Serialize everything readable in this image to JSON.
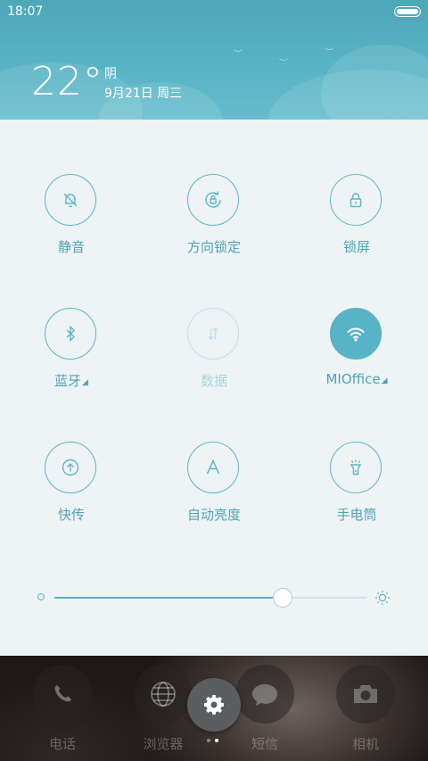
{
  "status_bar": {
    "time": "18:07",
    "battery_level": 1.0
  },
  "weather": {
    "temperature": "22°",
    "condition": "阴",
    "date": "9月21日 周三"
  },
  "toggles": [
    {
      "label": "静音",
      "icon": "bell-off-icon",
      "state": "off"
    },
    {
      "label": "方向锁定",
      "icon": "rotation-lock-icon",
      "state": "off"
    },
    {
      "label": "锁屏",
      "icon": "lock-icon",
      "state": "off"
    },
    {
      "label": "蓝牙",
      "icon": "bluetooth-icon",
      "state": "off",
      "has_menu": true
    },
    {
      "label": "数据",
      "icon": "mobile-data-icon",
      "state": "disabled"
    },
    {
      "label": "MIOffice",
      "icon": "wifi-icon",
      "state": "on",
      "has_menu": true
    },
    {
      "label": "快传",
      "icon": "share-upload-icon",
      "state": "off"
    },
    {
      "label": "自动亮度",
      "icon": "auto-brightness-icon",
      "state": "off"
    },
    {
      "label": "手电筒",
      "icon": "flashlight-icon",
      "state": "off"
    }
  ],
  "brightness": {
    "level": 0.73
  },
  "dock": [
    {
      "label": "电话",
      "icon": "phone-icon"
    },
    {
      "label": "浏览器",
      "icon": "globe-icon"
    },
    {
      "label": "短信",
      "icon": "message-icon"
    },
    {
      "label": "相机",
      "icon": "camera-icon"
    }
  ],
  "settings_icon": "gear-icon",
  "page_indicator": {
    "count": 2,
    "active": 1
  },
  "colors": {
    "accent": "#57b4c6",
    "header": "#58b3c4",
    "panel": "#eef3f5"
  },
  "menu_marker": "◢"
}
